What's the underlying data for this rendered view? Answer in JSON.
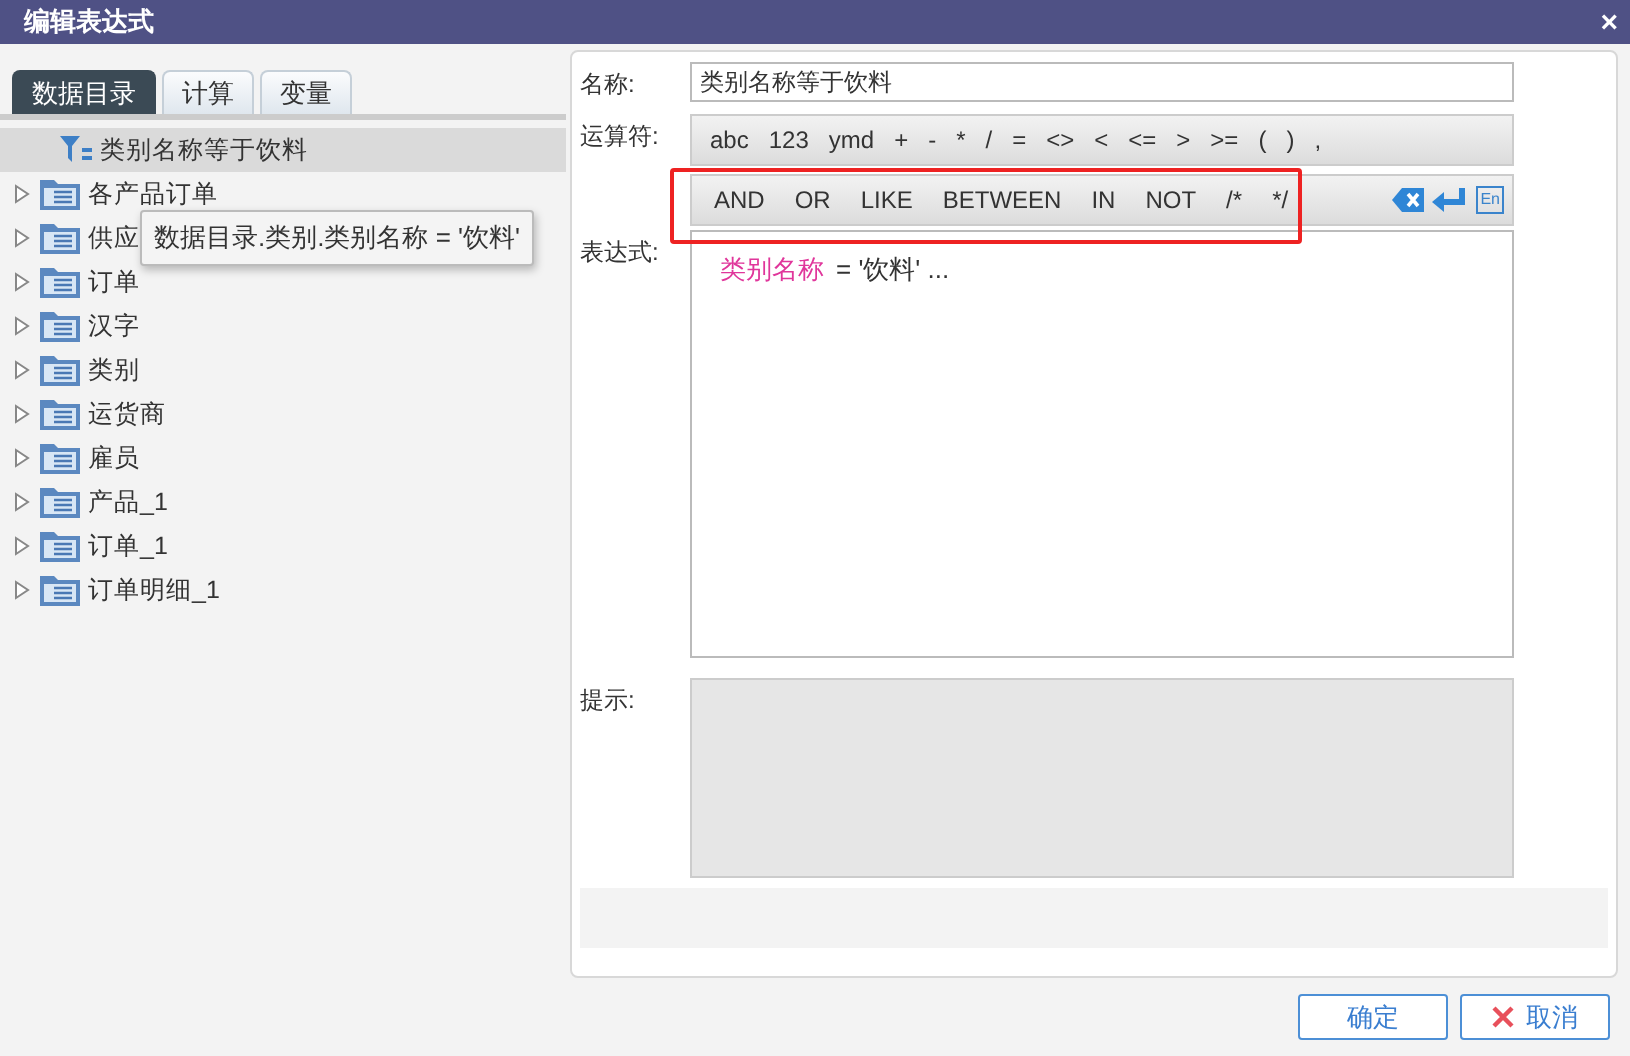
{
  "window": {
    "title": "编辑表达式",
    "close": "×"
  },
  "tabs": [
    {
      "label": "数据目录",
      "selected": true
    },
    {
      "label": "计算",
      "selected": false
    },
    {
      "label": "变量",
      "selected": false
    }
  ],
  "tree": {
    "items": [
      {
        "label": "类别名称等于饮料",
        "kind": "filter",
        "selected": true
      },
      {
        "label": "各产品订单",
        "kind": "table",
        "selected": false,
        "expanded": false
      },
      {
        "label": "供应",
        "kind": "table",
        "selected": false,
        "expanded": false
      },
      {
        "label": "订单",
        "kind": "table",
        "selected": false,
        "expanded": false
      },
      {
        "label": "汉字",
        "kind": "table",
        "selected": false,
        "expanded": false
      },
      {
        "label": "类别",
        "kind": "table",
        "selected": false,
        "expanded": false
      },
      {
        "label": "运货商",
        "kind": "table",
        "selected": false,
        "expanded": false
      },
      {
        "label": "雇员",
        "kind": "table",
        "selected": false,
        "expanded": false
      },
      {
        "label": "产品_1",
        "kind": "table",
        "selected": false,
        "expanded": false
      },
      {
        "label": "订单_1",
        "kind": "table",
        "selected": false,
        "expanded": false
      },
      {
        "label": "订单明细_1",
        "kind": "table",
        "selected": false,
        "expanded": false
      }
    ]
  },
  "tooltip": {
    "text": "数据目录.类别.类别名称 = '饮料'"
  },
  "form": {
    "name_label": "名称:",
    "name_value": "类别名称等于饮料",
    "operators_label": "运算符:",
    "operators": [
      "abc",
      "123",
      "ymd",
      "+",
      "-",
      "*",
      "/",
      "=",
      "<>",
      "<",
      "<=",
      ">",
      ">=",
      "(",
      ")",
      ","
    ],
    "logic": [
      "AND",
      "OR",
      "LIKE",
      "BETWEEN",
      "IN",
      "NOT",
      "/*",
      "*/"
    ],
    "lang_button": "En",
    "expression_label": "表达式:",
    "expression": [
      {
        "kind": "field",
        "text": "类别名称"
      },
      {
        "kind": "text",
        "text": "= '饮料' ..."
      }
    ],
    "hint_label": "提示:"
  },
  "buttons": [
    {
      "label": "确定",
      "kind": "ok"
    },
    {
      "label": "取消",
      "kind": "cancel"
    }
  ]
}
